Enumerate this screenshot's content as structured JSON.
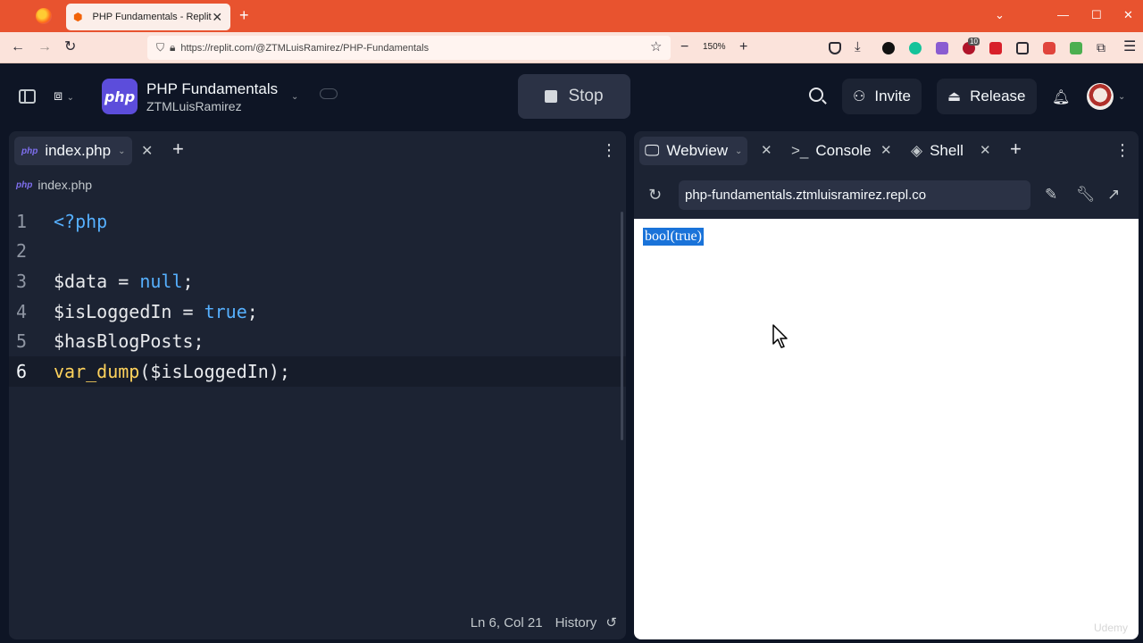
{
  "browser": {
    "tab_title": "PHP Fundamentals - Replit",
    "url": "https://replit.com/@ZTMLuisRamirez/PHP-Fundamentals",
    "zoom": "150%",
    "extension_badge": "10"
  },
  "header": {
    "project_name": "PHP Fundamentals",
    "owner": "ZTMLuisRamirez",
    "logo_text": "php",
    "stop_label": "Stop",
    "invite_label": "Invite",
    "release_label": "Release"
  },
  "editor": {
    "tab_label": "index.php",
    "file_icon_text": "php",
    "breadcrumb": "index.php",
    "lines": [
      {
        "num": "1",
        "tokens": [
          {
            "t": "<?php",
            "c": "kw"
          }
        ]
      },
      {
        "num": "2",
        "tokens": []
      },
      {
        "num": "3",
        "tokens": [
          {
            "t": "$data",
            "c": "var"
          },
          {
            "t": " = ",
            "c": "punc"
          },
          {
            "t": "null",
            "c": "kw"
          },
          {
            "t": ";",
            "c": "punc"
          }
        ]
      },
      {
        "num": "4",
        "tokens": [
          {
            "t": "$isLoggedIn",
            "c": "var"
          },
          {
            "t": " = ",
            "c": "punc"
          },
          {
            "t": "true",
            "c": "kw"
          },
          {
            "t": ";",
            "c": "punc"
          }
        ]
      },
      {
        "num": "5",
        "tokens": [
          {
            "t": "$hasBlogPosts",
            "c": "var"
          },
          {
            "t": ";",
            "c": "punc"
          }
        ]
      },
      {
        "num": "6",
        "tokens": [
          {
            "t": "var_dump",
            "c": "fn"
          },
          {
            "t": "(",
            "c": "punc"
          },
          {
            "t": "$isLoggedIn",
            "c": "var"
          },
          {
            "t": ");",
            "c": "punc"
          }
        ],
        "active": true
      }
    ],
    "cursor_position": "Ln 6, Col 21",
    "history_label": "History"
  },
  "right_pane": {
    "tabs": [
      {
        "label": "Webview",
        "icon": "monitor-icon",
        "active": true
      },
      {
        "label": "Console",
        "icon": "terminal-icon",
        "active": false
      },
      {
        "label": "Shell",
        "icon": "shell-icon",
        "active": false
      }
    ],
    "webview_url": "php-fundamentals.ztmluisramirez.repl.co",
    "output_text": "bool(true)"
  },
  "watermark": "Udemy",
  "colors": {
    "browser_tab_bar": "#e8532f",
    "replit_bg": "#0e1525",
    "panel_bg": "#1c2333",
    "keyword": "#56b0ff",
    "function": "#ffd35c",
    "selection": "#1a73d9"
  }
}
